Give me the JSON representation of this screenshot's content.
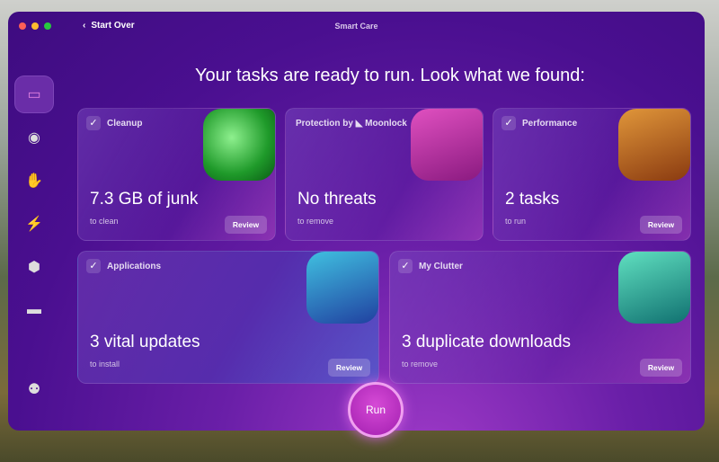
{
  "window": {
    "title": "Smart Care",
    "back_label": "Start Over"
  },
  "headline": "Your tasks are ready to run. Look what we found:",
  "sidebar": [
    {
      "icon": "smart-care-icon"
    },
    {
      "icon": "cleanup-icon"
    },
    {
      "icon": "protection-icon"
    },
    {
      "icon": "performance-icon"
    },
    {
      "icon": "applications-icon"
    },
    {
      "icon": "clutter-icon"
    },
    {
      "icon": "assistant-icon"
    }
  ],
  "cards": [
    {
      "title": "Cleanup",
      "value": "7.3 GB of junk",
      "sub": "to clean",
      "review": "Review",
      "checked": true
    },
    {
      "title": "Protection by",
      "brand": "Moonlock",
      "value": "No threats",
      "sub": "to remove"
    },
    {
      "title": "Performance",
      "value": "2 tasks",
      "sub": "to run",
      "review": "Review",
      "checked": true
    },
    {
      "title": "Applications",
      "value": "3 vital updates",
      "sub": "to install",
      "review": "Review",
      "checked": true
    },
    {
      "title": "My Clutter",
      "value": "3 duplicate downloads",
      "sub": "to remove",
      "review": "Review",
      "checked": true
    }
  ],
  "run_label": "Run",
  "check_glyph": "✓",
  "colors": {
    "accent": "#a21fb0"
  }
}
